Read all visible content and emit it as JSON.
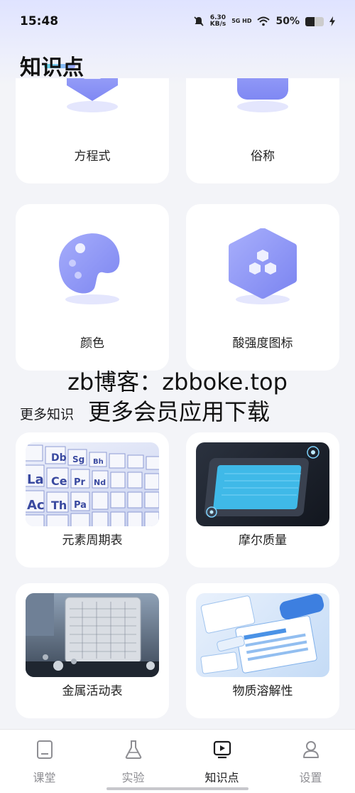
{
  "status_bar": {
    "time": "15:48",
    "net_speed_top": "6.30",
    "net_speed_bottom": "KB/s",
    "network": "5G HD",
    "battery": "50%",
    "battery_level": 0.5
  },
  "page": {
    "title": "知识点"
  },
  "icon_cards": [
    {
      "label": "方程式",
      "icon": "hexagon-shape-icon"
    },
    {
      "label": "俗称",
      "icon": "rounded-square-icon"
    },
    {
      "label": "颜色",
      "icon": "palette-icon"
    },
    {
      "label": "酸强度图标",
      "icon": "molecule-hexagon-icon"
    }
  ],
  "watermark": {
    "line1": "zb博客：zbboke.top",
    "line2": "更多会员应用下载"
  },
  "more_section": {
    "title": "更多知识",
    "cards": [
      {
        "label": "元素周期表",
        "image": "periodic-table-image"
      },
      {
        "label": "摩尔质量",
        "image": "mole-mass-device-image"
      },
      {
        "label": "金属活动表",
        "image": "metal-activity-tablet-image"
      },
      {
        "label": "物质溶解性",
        "image": "solubility-docs-image"
      }
    ]
  },
  "tab_bar": {
    "tabs": [
      {
        "label": "课堂",
        "icon": "book-icon",
        "active": false
      },
      {
        "label": "实验",
        "icon": "flask-icon",
        "active": false
      },
      {
        "label": "知识点",
        "icon": "play-screen-icon",
        "active": true
      },
      {
        "label": "设置",
        "icon": "person-icon",
        "active": false
      }
    ]
  },
  "colors": {
    "accent": "#8c95f6",
    "background": "#f3f4f8",
    "card": "#ffffff"
  }
}
